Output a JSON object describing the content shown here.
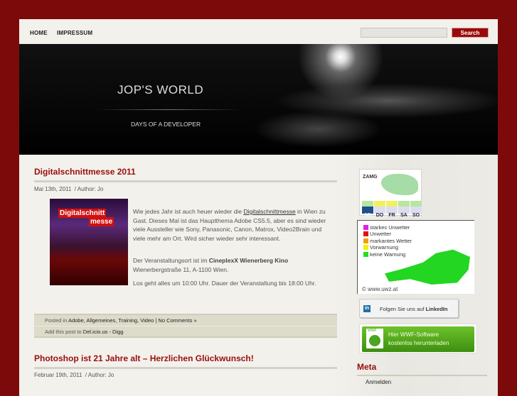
{
  "nav": {
    "items": [
      "HOME",
      "IMPRESSUM"
    ],
    "search_placeholder": "",
    "search_button": "Search"
  },
  "header": {
    "title": "JOP'S WORLD",
    "tagline": "DAYS OF A DEVELOPER"
  },
  "posts": [
    {
      "title": "Digitalschnittmesse 2011",
      "date": "Mai 13th, 2011",
      "author": "/ Author: Jo",
      "image_text": [
        "Digitalschnitt",
        "messe"
      ],
      "p1_before": "Wie jedes Jahr ist auch heuer wieder die ",
      "p1_link": "Digitalschnittmesse",
      "p1_after": " in Wien zu Gast. Dieses Mal ist das Hauptthema Adobe CS5.5, aber es sind wieder viele Aussteller wie Sony, Panasonic, Canon, Matrox, Video2Brain und viele mehr am Ort. Wird sicher wieder sehr interessant.",
      "p2_before": "Der Veranstaltungsort ist im ",
      "p2_bold": "CineplexX Wienerberg Kino",
      "p2_after": " Wienerbergstraße 11, A-1100 Wien.",
      "p3": "Los geht alles um 10:00 Uhr. Dauer der Veranstaltung bis 18:00 Uhr.",
      "posted_in": "Posted in",
      "categories": "Adobe, Allgemeines, Training, Video | No Comments »",
      "add_post": "Add this post to",
      "share": "Del.icio.us - Digg"
    },
    {
      "title": "Photoshop ist 21 Jahre alt – Herzlichen Glückwunsch!",
      "date": "Februar 19th, 2011",
      "author": "/ Author: Jo"
    }
  ],
  "sidebar": {
    "zamg": {
      "logo": "ZAMG",
      "days": [
        "MI",
        "DO",
        "FR",
        "SA",
        "SO"
      ]
    },
    "uwz": {
      "legend": [
        {
          "label": "starkes Unwetter",
          "color": "#e020e0"
        },
        {
          "label": "Unwetter",
          "color": "#e01010"
        },
        {
          "label": "markantes Wetter",
          "color": "#f0a000"
        },
        {
          "label": "Vorwarnung",
          "color": "#f0f000"
        },
        {
          "label": "keine Warnung",
          "color": "#20e020"
        }
      ],
      "copyright": "© www.uwz.at"
    },
    "linkedin": {
      "icon": "in",
      "text_pre": "Folgen Sie uns auf ",
      "text_bold": "LinkedIn"
    },
    "wwf": {
      "badge": "WWF",
      "line1": "Hier WWF-Software",
      "line2": "kostenlos herunterladen"
    },
    "meta_heading": "Meta",
    "meta_links": [
      "Anmelden"
    ]
  }
}
